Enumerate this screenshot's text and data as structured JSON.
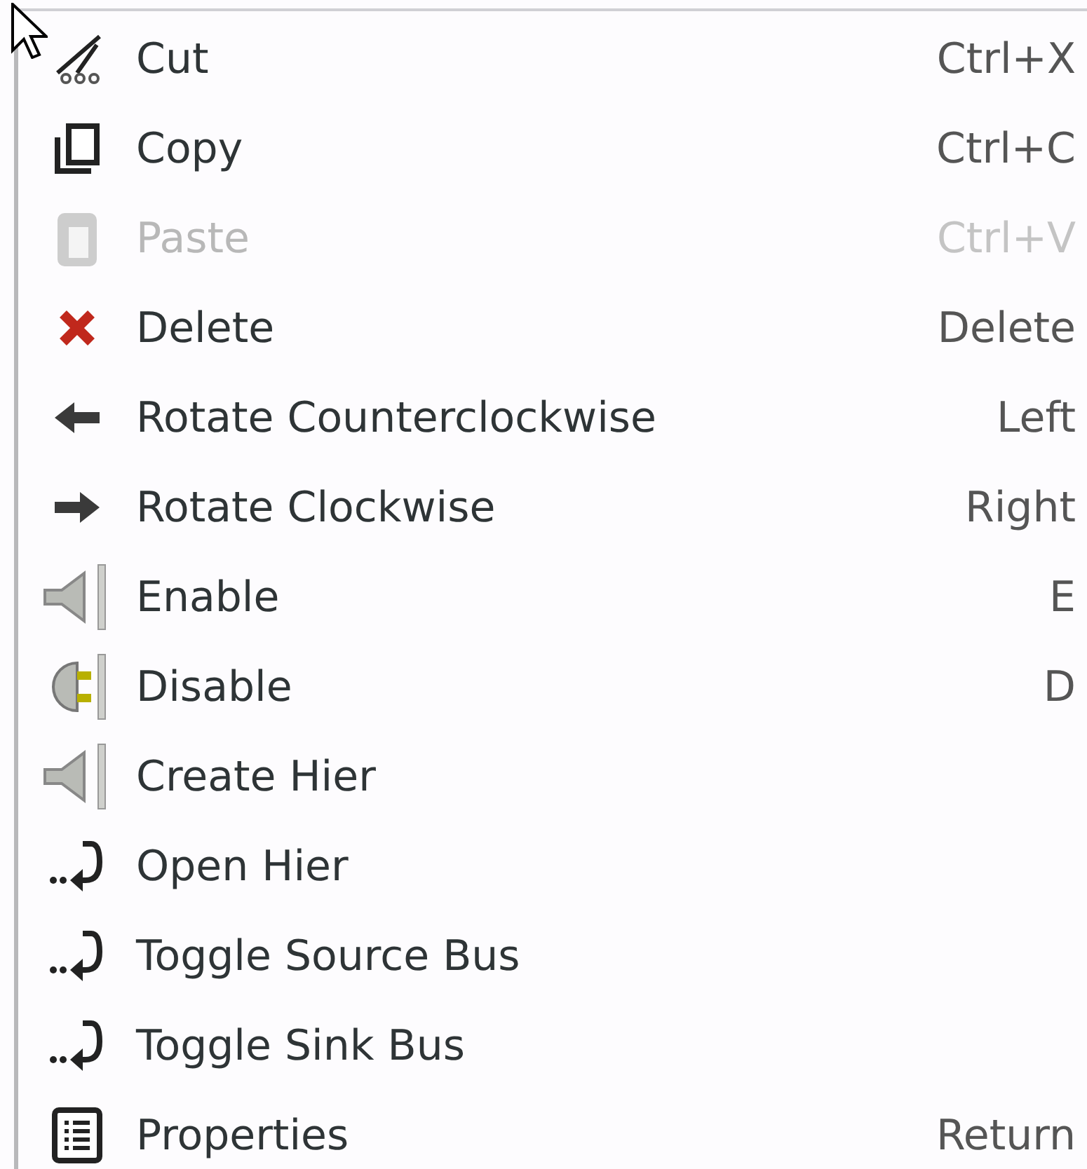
{
  "menu": {
    "items": [
      {
        "kind": "cut",
        "label": "Cut",
        "shortcut": "Ctrl+X",
        "disabled": false
      },
      {
        "kind": "copy",
        "label": "Copy",
        "shortcut": "Ctrl+C",
        "disabled": false
      },
      {
        "kind": "paste",
        "label": "Paste",
        "shortcut": "Ctrl+V",
        "disabled": true
      },
      {
        "kind": "delete",
        "label": "Delete",
        "shortcut": "Delete",
        "disabled": false
      },
      {
        "kind": "rotateleft",
        "label": "Rotate Counterclockwise",
        "shortcut": "Left",
        "disabled": false
      },
      {
        "kind": "rotateright",
        "label": "Rotate Clockwise",
        "shortcut": "Right",
        "disabled": false
      },
      {
        "kind": "enable",
        "label": "Enable",
        "shortcut": "E",
        "disabled": false
      },
      {
        "kind": "disable",
        "label": "Disable",
        "shortcut": "D",
        "disabled": false
      },
      {
        "kind": "hier",
        "label": "Create Hier",
        "disabled": false
      },
      {
        "kind": "jump",
        "label": "Open Hier",
        "disabled": false
      },
      {
        "kind": "jump",
        "label": "Toggle Source Bus",
        "disabled": false
      },
      {
        "kind": "jump",
        "label": "Toggle Sink Bus",
        "disabled": false
      },
      {
        "kind": "properties",
        "label": "Properties",
        "shortcut": "Return",
        "disabled": false
      }
    ]
  }
}
